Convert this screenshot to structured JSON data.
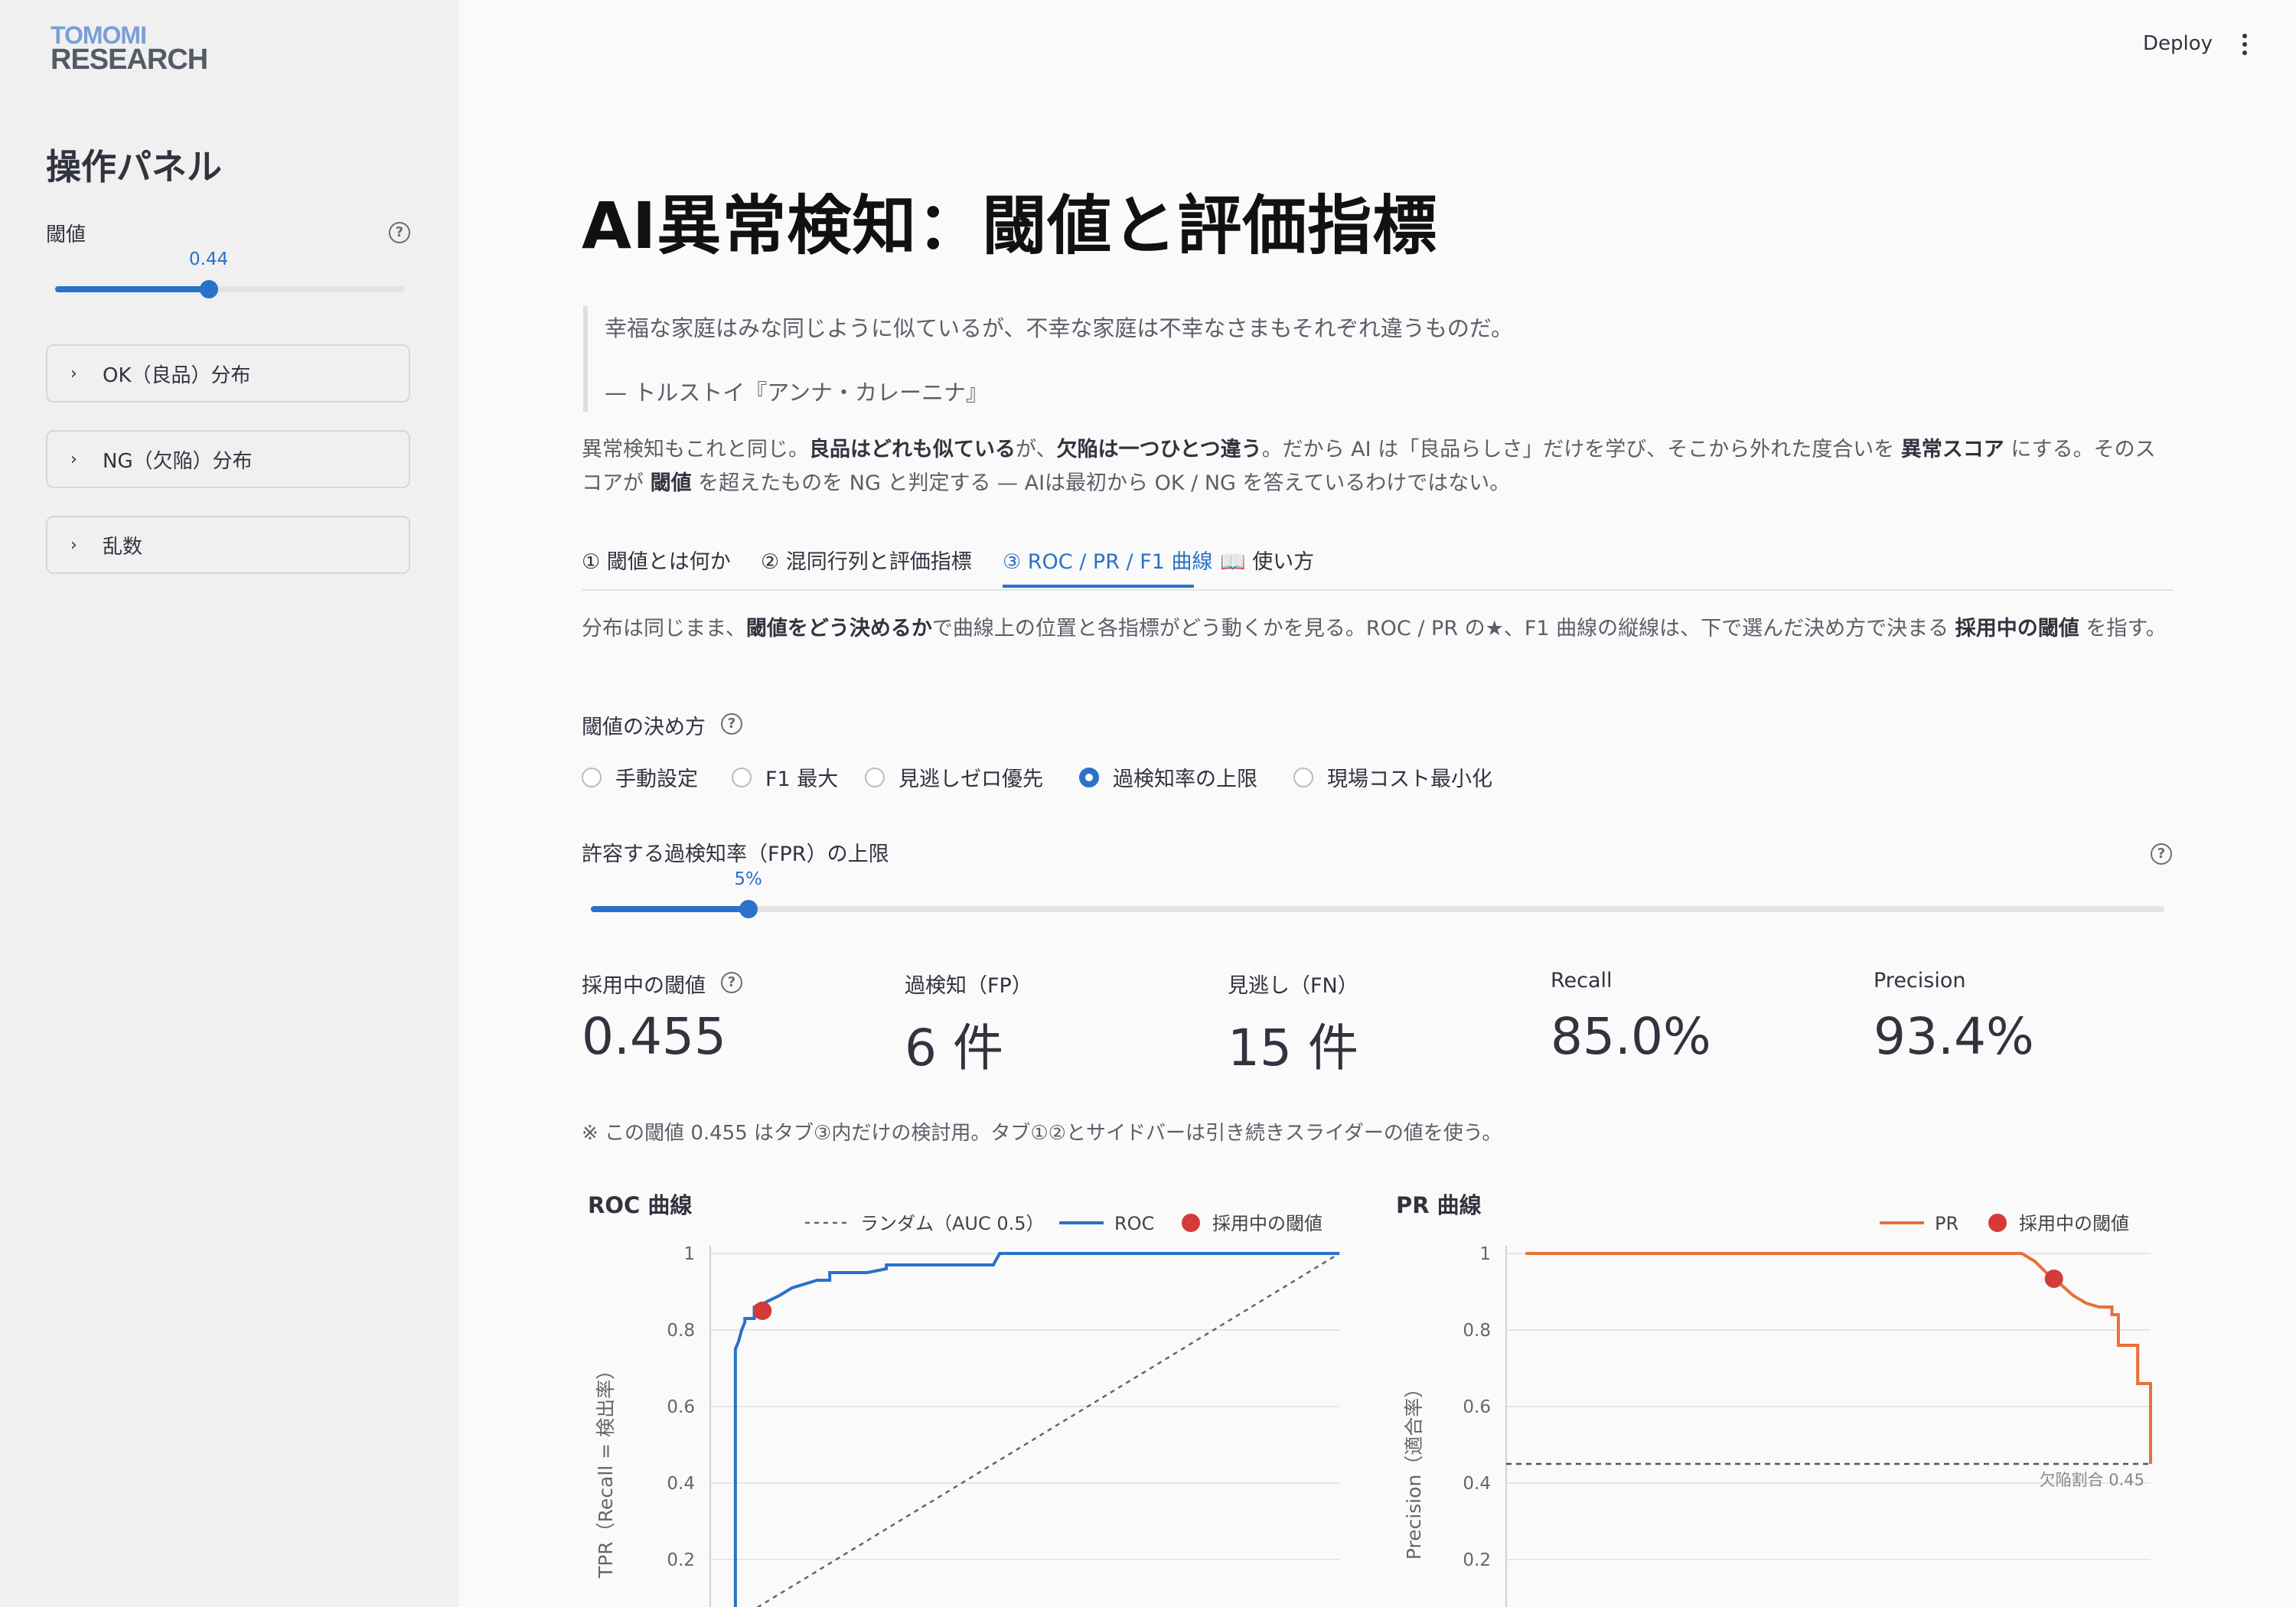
{
  "sidebar": {
    "logo_line1": "TOMOMI",
    "logo_line2": "RESEARCH",
    "title": "操作パネル",
    "threshold_label": "閾値",
    "threshold_value": "0.44",
    "threshold_fraction": 0.44,
    "expanders": [
      {
        "label": "OK（良品）分布"
      },
      {
        "label": "NG（欠陥）分布"
      },
      {
        "label": "乱数"
      }
    ]
  },
  "topbar": {
    "deploy_label": "Deploy"
  },
  "main": {
    "title": "AI異常検知：閾値と評価指標",
    "quote": "幸福な家庭はみな同じように似ているが、不幸な家庭は不幸なさまもそれぞれ違うものだ。",
    "quote_source": "— トルストイ『アンナ・カレーニナ』",
    "intro": {
      "s1": "異常検知もこれと同じ。",
      "b1": "良品はどれも似ている",
      "s2": "が、",
      "b2": "欠陥は一つひとつ違う",
      "s3": "。だから AI は「良品らしさ」だけを学び、そこから外れた度合いを ",
      "b3": "異常スコア",
      "s4": " にする。そのスコアが ",
      "b4": "閾値",
      "s5": " を超えたものを NG と判定する — AIは最初から OK / NG を答えているわけではない。"
    },
    "tabs": [
      {
        "label": "① 閾値とは何か"
      },
      {
        "label": "② 混同行列と評価指標"
      },
      {
        "label": "③ ROC / PR / F1 曲線"
      },
      {
        "label": "📖 使い方"
      }
    ],
    "tab_desc": {
      "s1": "分布は同じまま、",
      "b1": "閾値をどう決めるか",
      "s2": "で曲線上の位置と各指標がどう動くかを見る。ROC / PR の★、F1 曲線の縦線は、下で選んだ決め方で決まる ",
      "b2": "採用中の閾値",
      "s3": " を指す。"
    },
    "method_label": "閾値の決め方",
    "methods": [
      {
        "label": "手動設定",
        "selected": false
      },
      {
        "label": "F1 最大",
        "selected": false
      },
      {
        "label": "見逃しゼロ優先",
        "selected": false
      },
      {
        "label": "過検知率の上限",
        "selected": true
      },
      {
        "label": "現場コスト最小化",
        "selected": false
      }
    ],
    "fpr_label": "許容する過検知率（FPR）の上限",
    "fpr_value": "5%",
    "fpr_fraction": 0.1,
    "metrics": [
      {
        "label": "採用中の閾値",
        "value": "0.455"
      },
      {
        "label": "過検知（FP）",
        "value": "6 件"
      },
      {
        "label": "見逃し（FN）",
        "value": "15 件"
      },
      {
        "label": "Recall",
        "value": "85.0%"
      },
      {
        "label": "Precision",
        "value": "93.4%"
      }
    ],
    "note": "※ この閾値 0.455 はタブ③内だけの検討用。タブ①②とサイドバーは引き続きスライダーの値を使う。"
  },
  "colors": {
    "accent": "#2a71c9",
    "pr_line": "#e8703a",
    "marker": "#d43a3a"
  },
  "chart_data": [
    {
      "type": "line",
      "title": "ROC 曲線",
      "ylabel": "TPR（Recall = 検出率）",
      "ylim": [
        0,
        1
      ],
      "yticks": [
        "0.2",
        "0.4",
        "0.6",
        "0.8",
        "1"
      ],
      "legend_position": "top-right",
      "legend": [
        "ランダム（AUC 0.5）",
        "ROC",
        "採用中の閾値"
      ],
      "series": [
        {
          "name": "ランダム（AUC 0.5）",
          "x": [
            0,
            1
          ],
          "y": [
            0,
            1
          ]
        },
        {
          "name": "ROC",
          "x": [
            0.04,
            0.04,
            0.045,
            0.05,
            0.055,
            0.055,
            0.07,
            0.07,
            0.08,
            0.085,
            0.11,
            0.13,
            0.17,
            0.19,
            0.19,
            0.2,
            0.25,
            0.28,
            0.28,
            0.45,
            0.46,
            1.0
          ],
          "y": [
            0,
            0.75,
            0.77,
            0.8,
            0.82,
            0.83,
            0.83,
            0.86,
            0.87,
            0.87,
            0.89,
            0.91,
            0.93,
            0.93,
            0.95,
            0.95,
            0.95,
            0.96,
            0.97,
            0.97,
            1.0,
            1.0
          ]
        }
      ],
      "points": [
        {
          "name": "採用中の閾値",
          "x": 0.083,
          "y": 0.85
        }
      ]
    },
    {
      "type": "line",
      "title": "PR 曲線",
      "ylabel": "Precision（適合率）",
      "ylim": [
        0,
        1
      ],
      "yticks": [
        "0.2",
        "0.4",
        "0.6",
        "0.8",
        "1"
      ],
      "legend_position": "top-right",
      "legend": [
        "PR",
        "採用中の閾値"
      ],
      "baseline": {
        "y": 0.45,
        "label": "欠陥割合 0.45"
      },
      "series": [
        {
          "name": "PR",
          "x": [
            0.03,
            0.2,
            0.4,
            0.6,
            0.75,
            0.8,
            0.82,
            0.85,
            0.86,
            0.88,
            0.9,
            0.92,
            0.94,
            0.94,
            0.95,
            0.95,
            0.98,
            0.98,
            1.0,
            1.0
          ],
          "y": [
            1.0,
            1.0,
            1.0,
            1.0,
            1.0,
            1.0,
            0.98,
            0.93,
            0.92,
            0.89,
            0.87,
            0.86,
            0.86,
            0.84,
            0.84,
            0.76,
            0.76,
            0.66,
            0.66,
            0.45
          ]
        }
      ],
      "points": [
        {
          "name": "採用中の閾値",
          "x": 0.85,
          "y": 0.934
        }
      ]
    }
  ]
}
